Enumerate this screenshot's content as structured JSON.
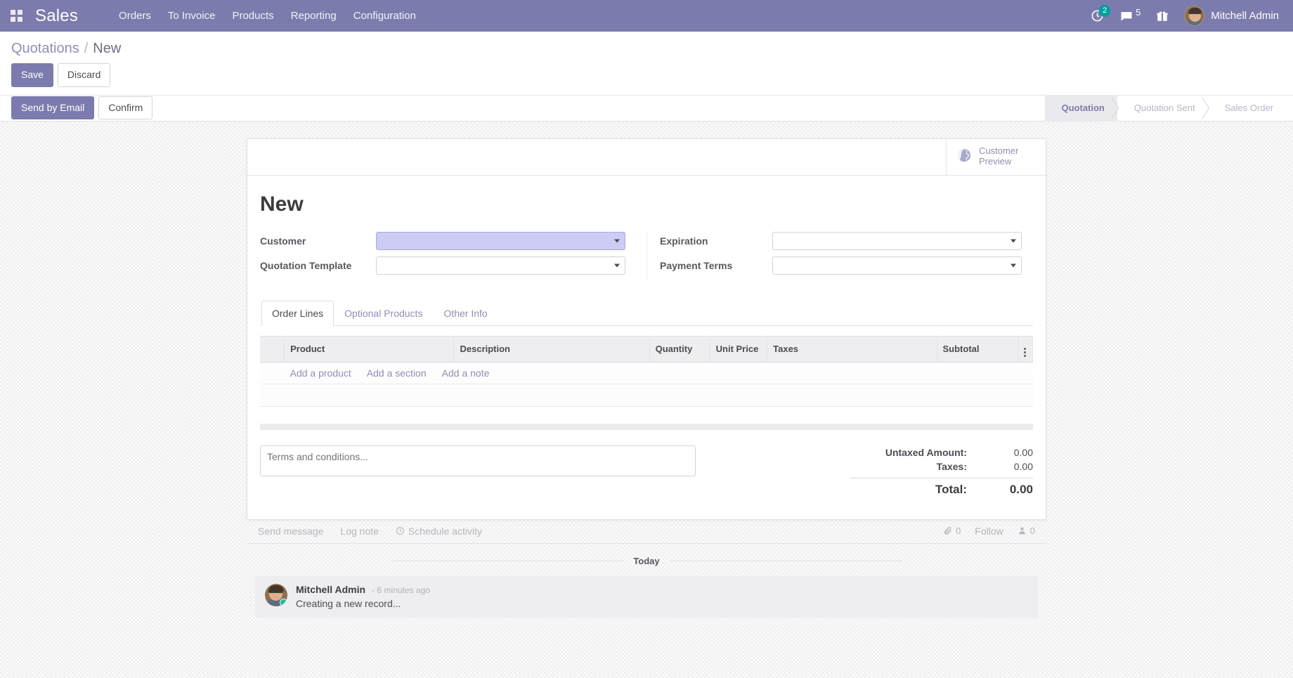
{
  "navbar": {
    "apps_icon": "apps-grid-icon",
    "brand": "Sales",
    "menus": [
      {
        "label": "Orders"
      },
      {
        "label": "To Invoice"
      },
      {
        "label": "Products"
      },
      {
        "label": "Reporting"
      },
      {
        "label": "Configuration"
      }
    ],
    "activities": {
      "icon": "clock-activity-icon",
      "count": "2"
    },
    "messages": {
      "icon": "chat-bubble-icon",
      "count": "5"
    },
    "gift": {
      "icon": "gift-icon"
    },
    "user": {
      "name": "Mitchell Admin",
      "avatar": "user-avatar"
    },
    "bg_color": "#7c7bad"
  },
  "breadcrumb": {
    "root": "Quotations",
    "separator": "/",
    "current": "New"
  },
  "record_buttons": {
    "save": "Save",
    "discard": "Discard"
  },
  "action_buttons": {
    "send_by_email": "Send by Email",
    "confirm": "Confirm"
  },
  "statusbar": {
    "stages": [
      {
        "label": "Quotation",
        "active": true
      },
      {
        "label": "Quotation Sent",
        "active": false
      },
      {
        "label": "Sales Order",
        "active": false
      }
    ],
    "active_color": "#7c7bad"
  },
  "stat_buttons": {
    "customer_preview": {
      "line1": "Customer",
      "line2": "Preview",
      "icon": "globe-icon"
    }
  },
  "form": {
    "title": "New",
    "left_fields": [
      {
        "label": "Customer",
        "value": "",
        "placeholder": "",
        "highlighted": true
      },
      {
        "label": "Quotation Template",
        "value": "",
        "placeholder": "",
        "highlighted": false
      }
    ],
    "right_fields": [
      {
        "label": "Expiration",
        "value": "",
        "placeholder": "",
        "highlighted": false
      },
      {
        "label": "Payment Terms",
        "value": "",
        "placeholder": "",
        "highlighted": false
      }
    ]
  },
  "notebook": {
    "tabs": [
      {
        "label": "Order Lines",
        "active": true
      },
      {
        "label": "Optional Products",
        "active": false
      },
      {
        "label": "Other Info",
        "active": false
      }
    ]
  },
  "order_lines": {
    "columns": [
      "Product",
      "Description",
      "Quantity",
      "Unit Price",
      "Taxes",
      "Subtotal"
    ],
    "rows": [],
    "add_links": [
      "Add a product",
      "Add a section",
      "Add a note"
    ],
    "optional_columns_icon": "vertical-dots-icon"
  },
  "terms": {
    "placeholder": "Terms and conditions...",
    "value": ""
  },
  "totals": {
    "untaxed_label": "Untaxed Amount:",
    "untaxed_value": "0.00",
    "taxes_label": "Taxes:",
    "taxes_value": "0.00",
    "total_label": "Total:",
    "total_value": "0.00"
  },
  "chatter": {
    "send_message": "Send message",
    "log_note": "Log note",
    "schedule_activity": "Schedule activity",
    "schedule_icon": "clock-icon",
    "attachment_icon": "paperclip-icon",
    "attachment_count": "0",
    "follow_label": "Follow",
    "followers_icon": "user-icon",
    "followers_count": "0",
    "day_separator": "Today",
    "messages": [
      {
        "author": "Mitchell Admin",
        "time": "- 6 minutes ago",
        "body": "Creating a new record...",
        "status": "online"
      }
    ]
  }
}
